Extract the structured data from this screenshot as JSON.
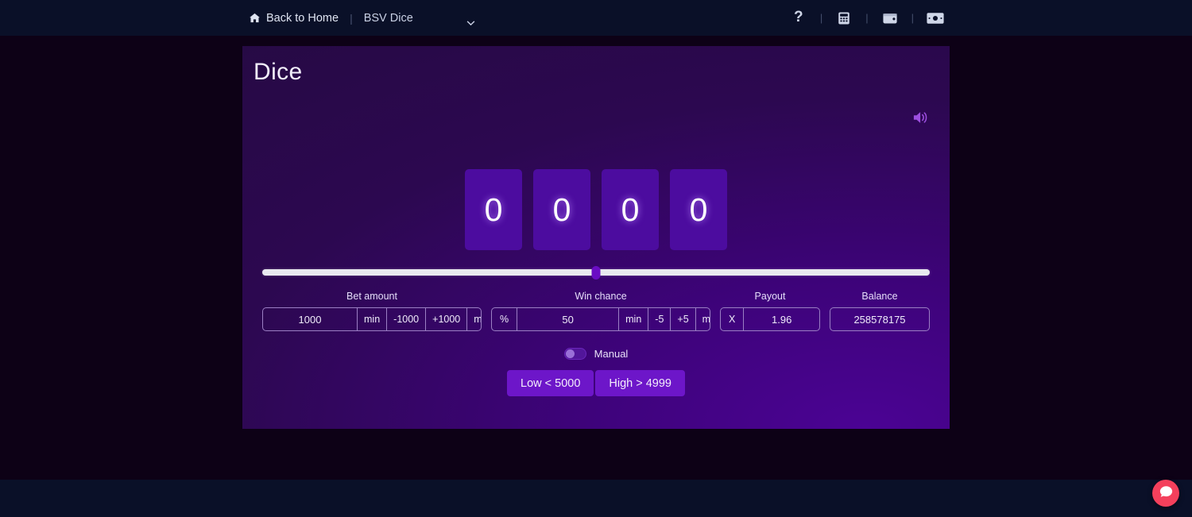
{
  "navbar": {
    "home_label": "Back to Home",
    "home_icon": "home-icon",
    "separator": "|",
    "game_select": {
      "selected": "BSV Dice",
      "chevron_icon": "chevron-down-icon"
    },
    "actions": [
      {
        "icon": "question-mark-icon",
        "glyph": "?"
      },
      {
        "icon": "calculator-icon"
      },
      {
        "icon": "wallet-icon"
      },
      {
        "icon": "banknote-icon"
      }
    ]
  },
  "card": {
    "title": "Dice",
    "sound_icon": "speaker-volume-icon",
    "dice": [
      "0",
      "0",
      "0",
      "0"
    ],
    "slider": {
      "value": 50,
      "min": 0,
      "max": 100
    },
    "fields": {
      "bet": {
        "label": "Bet amount",
        "value": "1000",
        "buttons": [
          "min",
          "-1000",
          "+1000",
          "max"
        ]
      },
      "win_chance": {
        "label": "Win chance",
        "prefix": "%",
        "value": "50",
        "buttons": [
          "min",
          "-5",
          "+5",
          "max"
        ]
      },
      "payout": {
        "label": "Payout",
        "prefix": "X",
        "value": "1.96"
      },
      "balance": {
        "label": "Balance",
        "value": "258578175"
      }
    },
    "manual": {
      "label": "Manual",
      "enabled": false
    },
    "bet_buttons": [
      {
        "label": "Low < 5000"
      },
      {
        "label": "High > 4999"
      }
    ]
  },
  "chat": {
    "icon": "chat-bubble-icon"
  },
  "colors": {
    "nav_bg": "#0a1028",
    "page_bg": "#0d0116",
    "card_from": "#250a42",
    "card_to": "#4b0394",
    "die_bg": "#4c0c9f",
    "bet_button": "#6d16c9",
    "chat_fab": "#f4405c",
    "slider_track": "#e9e9ef",
    "slider_thumb": "#6a0dc4"
  }
}
